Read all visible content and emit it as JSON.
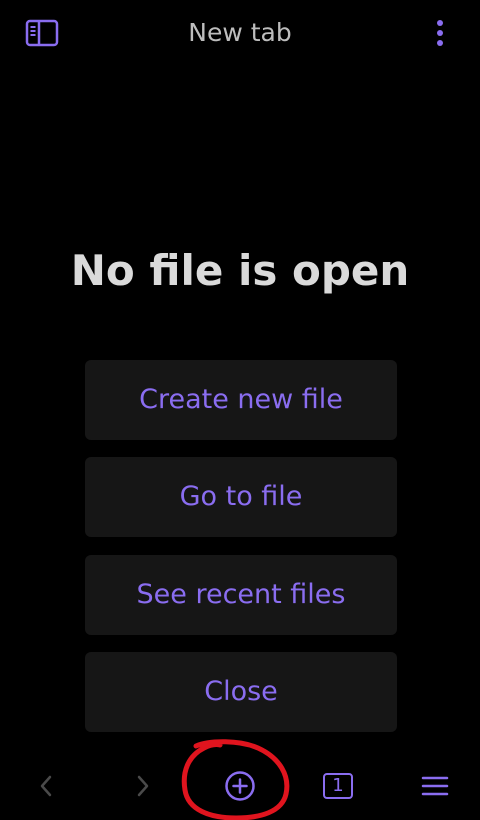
{
  "header": {
    "title": "New tab",
    "sidebar_toggle_icon": "sidebar-toggle-icon",
    "more_icon": "more-vertical-icon"
  },
  "main": {
    "title": "No file is open",
    "actions": [
      {
        "label": "Create new file"
      },
      {
        "label": "Go to file"
      },
      {
        "label": "See recent files"
      },
      {
        "label": "Close"
      }
    ]
  },
  "bottom_bar": {
    "back_icon": "chevron-left-icon",
    "forward_icon": "chevron-right-icon",
    "new_tab_icon": "plus-circle-icon",
    "tab_count": "1",
    "menu_icon": "hamburger-menu-icon"
  },
  "colors": {
    "accent": "#8a6df0",
    "background": "#000000",
    "button_background": "#161616",
    "title_text": "#dadada",
    "header_text": "#bdbdbd",
    "disabled_icon": "#4a4a4a",
    "annotation": "#e0141e"
  }
}
